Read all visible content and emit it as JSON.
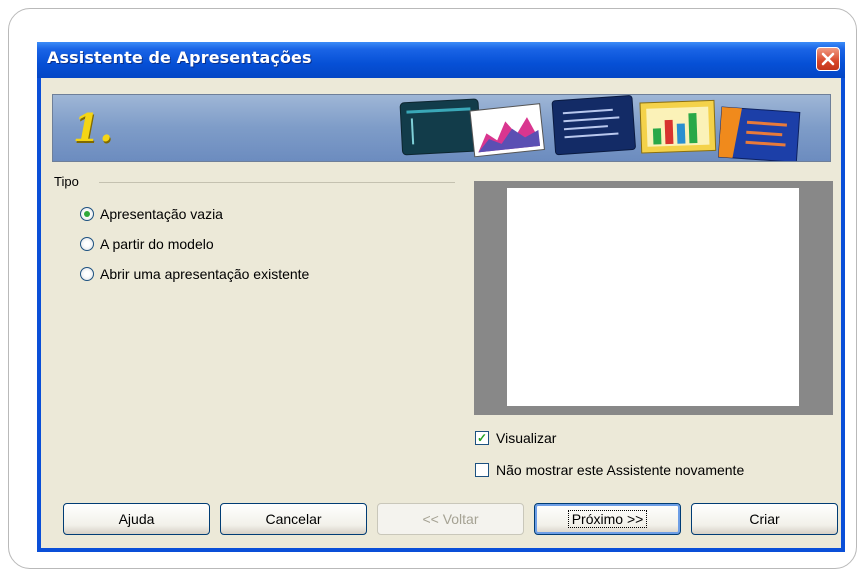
{
  "window": {
    "title": "Assistente de Apresentações"
  },
  "banner": {
    "step_number": "1."
  },
  "type_group": {
    "label": "Tipo",
    "options": [
      {
        "label": "Apresentação vazia",
        "selected": true
      },
      {
        "label": "A partir do modelo",
        "selected": false
      },
      {
        "label": "Abrir uma apresentação existente",
        "selected": false
      }
    ]
  },
  "checks": {
    "preview": {
      "label": "Visualizar",
      "checked": true
    },
    "dont_show": {
      "label": "Não mostrar este Assistente novamente",
      "checked": false
    }
  },
  "buttons": {
    "help": "Ajuda",
    "cancel": "Cancelar",
    "back": "<< Voltar",
    "next": "Próximo >>",
    "create": "Criar"
  },
  "colors": {
    "titlebar": "#0650d6",
    "dialog_bg": "#ece9d8",
    "close_red": "#d8472a",
    "radio_dot": "#2fa83a"
  }
}
